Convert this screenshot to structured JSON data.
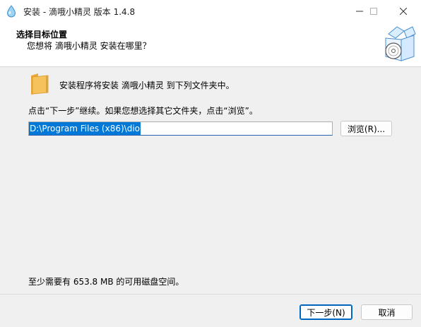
{
  "window": {
    "title": "安装 - 滴哦小精灵 版本 1.4.8",
    "controls": {
      "minimize_icon": "minimize-icon",
      "maximize_icon": "maximize-icon",
      "close_icon": "close-icon"
    }
  },
  "header": {
    "title": "选择目标位置",
    "subtitle": "您想将 滴哦小精灵 安装在哪里？"
  },
  "content": {
    "intro": "安装程序将安装 滴哦小精灵 到下列文件夹中。",
    "instruction": "点击“下一步”继续。如果您想选择其它文件夹，点击“浏览”。",
    "install_path": "D:\\Program Files (x86)\\dio",
    "browse_label": "浏览(R)...",
    "space_required": "至少需要有 653.8 MB 的可用磁盘空间。"
  },
  "footer": {
    "next_label": "下一步(N)",
    "cancel_label": "取消"
  },
  "colors": {
    "accent": "#0078d7",
    "window_bg": "#f0f0f0",
    "header_bg": "#ffffff",
    "folder": "#f2b84b"
  }
}
